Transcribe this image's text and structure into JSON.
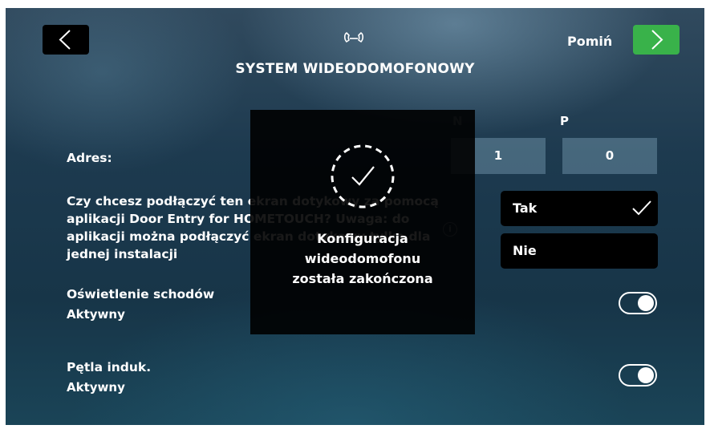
{
  "header": {
    "title": "SYSTEM WIDEODOMOFONOWY",
    "skip_label": "Pomiń",
    "icons": {
      "back": "chevron-left-icon",
      "next": "chevron-right-icon",
      "phone": "handset-icon"
    }
  },
  "address": {
    "label": "Adres:",
    "columns": [
      "N",
      "P"
    ],
    "values": [
      "1",
      "0"
    ]
  },
  "question": {
    "text": "Czy chcesz podłączyć ten ekran dotykowy za pomocą aplikacji Door Entry for HOMETOUCH? Uwaga: do aplikacji można podłączyć ekran dotykowy tylko dla jednej instalacji",
    "options": [
      {
        "label": "Tak",
        "selected": true
      },
      {
        "label": "Nie",
        "selected": false
      }
    ]
  },
  "settings": [
    {
      "name": "Oświetlenie schodów",
      "status": "Aktywny",
      "on": true
    },
    {
      "name": "Pętla induk.",
      "status": "Aktywny",
      "on": true
    }
  ],
  "modal": {
    "message": "Konfiguracja\nwideodomofonu\nzostała zakończona",
    "icon": "check-circle-icon"
  },
  "colors": {
    "next_button": "#39b24a",
    "option_background": "#000000",
    "address_box": "#5e7c8c"
  }
}
